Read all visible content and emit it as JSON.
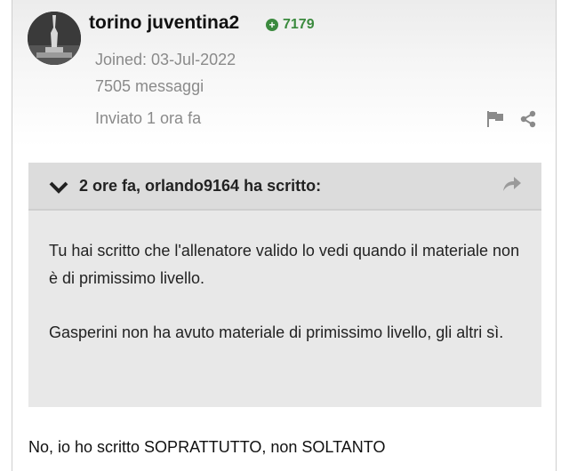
{
  "post": {
    "author": "torino juventina2",
    "reputation": "7179",
    "joined": "Joined: 03-Jul-2022",
    "message_count": "7505 messaggi",
    "posted": "Inviato 1 ora fa",
    "icons": [
      "avatar",
      "plus-circle-icon",
      "flag-icon",
      "share-icon"
    ]
  },
  "quote": {
    "header": "2 ore fa, orlando9164 ha scritto:",
    "paragraphs": [
      "Tu hai scritto che l'allenatore valido lo vedi quando il materiale non è di primissimo livello.",
      "Gasperini non ha avuto materiale di primissimo livello, gli altri sì."
    ],
    "icons": [
      "chevron-down-icon",
      "reply-arrow-icon"
    ]
  },
  "body_text": "No, io ho scritto SOPRATTUTTO, non SOLTANTO",
  "colors": {
    "reputation": "#3b8a3e",
    "quote_bg": "#e8e8e8",
    "quote_header_bg": "#dcdcdc",
    "meta_text": "#8a8a8a"
  }
}
